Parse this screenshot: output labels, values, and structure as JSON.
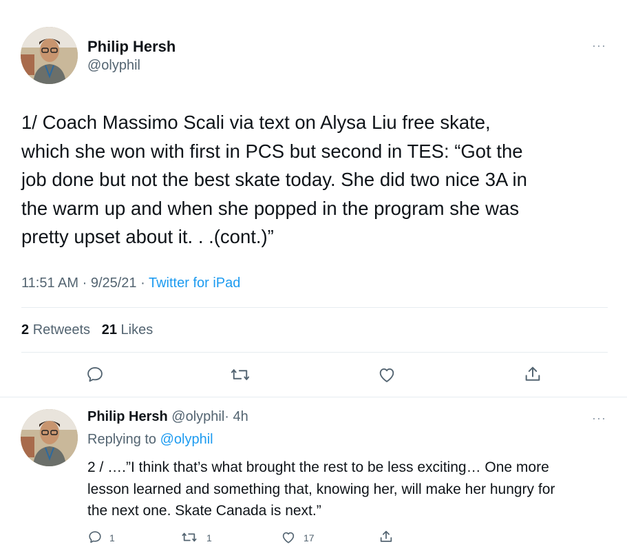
{
  "tweet": {
    "author_name": "Philip Hersh",
    "author_handle": "@olyphil",
    "text": "1/ Coach Massimo Scali via text on Alysa Liu free skate,\nwhich she won with first in PCS but second in TES:  “Got the\njob done but not the best skate today. She did two nice 3A in\nthe warm up and when she popped in the program  she was\npretty upset about it. . .(cont.)”",
    "time": "11:51 AM",
    "date": "9/25/21",
    "separator": "·",
    "source": "Twitter for iPad",
    "retweets_count": "2",
    "retweets_label": "Retweets",
    "likes_count": "21",
    "likes_label": "Likes",
    "more": "···"
  },
  "reply": {
    "author_name": "Philip Hersh",
    "author_handle": "@olyphil",
    "age": "· 4h",
    "replying_label": "Replying to",
    "replying_handle": "@olyphil",
    "text": "2 / ….”I think that’s what brought the rest to be less exciting… One more\nlesson learned and something that, knowing her, will make her hungry for\nthe next one. Skate Canada is next.”",
    "reply_count": "1",
    "retweet_count": "1",
    "like_count": "17",
    "more": "···"
  },
  "icons": {
    "reply": "comment-icon",
    "retweet": "retweet-icon",
    "like": "heart-icon",
    "share": "share-icon",
    "more": "more-icon"
  }
}
